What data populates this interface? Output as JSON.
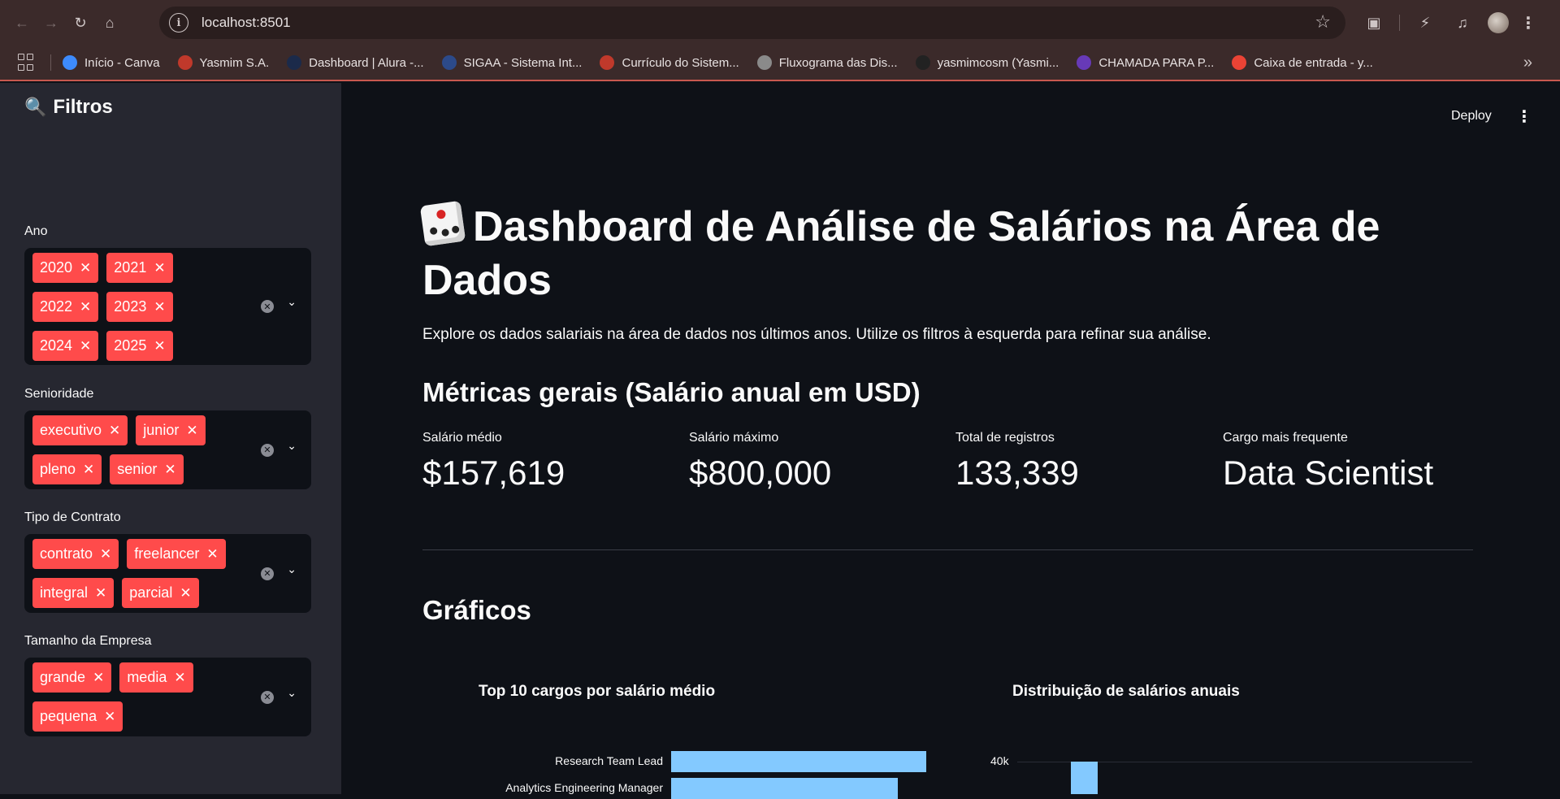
{
  "browser": {
    "url": "localhost:8501",
    "bookmarks": [
      {
        "label": "Início - Canva",
        "icon": "canva-icon",
        "color": "#3d8bfd"
      },
      {
        "label": "Yasmim S.A.",
        "icon": "rose-icon",
        "color": "#c0392b"
      },
      {
        "label": "Dashboard | Alura -...",
        "icon": "alura-icon",
        "color": "#1b2a4a"
      },
      {
        "label": "SIGAA - Sistema Int...",
        "icon": "sigaa-icon",
        "color": "#2c4a8a"
      },
      {
        "label": "Currículo do Sistem...",
        "icon": "lattes-icon",
        "color": "#c0392b"
      },
      {
        "label": "Fluxograma das Dis...",
        "icon": "globe-icon",
        "color": "#8a8a8a"
      },
      {
        "label": "yasmimcosm (Yasmi...",
        "icon": "github-icon",
        "color": "#222222"
      },
      {
        "label": "CHAMADA PARA P...",
        "icon": "forms-icon",
        "color": "#673ab7"
      },
      {
        "label": "Caixa de entrada - y...",
        "icon": "gmail-icon",
        "color": "#ea4335"
      }
    ]
  },
  "header": {
    "deploy_label": "Deploy"
  },
  "sidebar": {
    "title": "Filtros",
    "filters": [
      {
        "label": "Ano",
        "chips": [
          "2020",
          "2021",
          "2022",
          "2023",
          "2024",
          "2025"
        ]
      },
      {
        "label": "Senioridade",
        "chips": [
          "executivo",
          "junior",
          "pleno",
          "senior"
        ]
      },
      {
        "label": "Tipo de Contrato",
        "chips": [
          "contrato",
          "freelancer",
          "integral",
          "parcial"
        ]
      },
      {
        "label": "Tamanho da Empresa",
        "chips": [
          "grande",
          "media",
          "pequena"
        ]
      }
    ]
  },
  "main": {
    "title": "Dashboard de Análise de Salários na Área de Dados",
    "intro": "Explore os dados salariais na área de dados nos últimos anos. Utilize os filtros à esquerda para refinar sua análise.",
    "metrics_heading": "Métricas gerais (Salário anual em USD)",
    "metrics": [
      {
        "label": "Salário médio",
        "value": "$157,619"
      },
      {
        "label": "Salário máximo",
        "value": "$800,000"
      },
      {
        "label": "Total de registros",
        "value": "133,339"
      },
      {
        "label": "Cargo mais frequente",
        "value": "Data Scientist"
      }
    ],
    "charts_heading": "Gráficos",
    "chart_titles": {
      "left": "Top 10 cargos por salário médio",
      "right": "Distribuição de salários anuais"
    }
  },
  "chart_data": [
    {
      "type": "bar",
      "title": "Top 10 cargos por salário médio",
      "orientation": "horizontal",
      "categories": [
        "Research Team Lead",
        "Analytics Engineering Manager"
      ],
      "values": [
        100,
        89
      ],
      "color": "#83c9ff"
    },
    {
      "type": "bar",
      "title": "Distribuição de salários anuais",
      "ytick_labels": [
        "40k"
      ],
      "color": "#83c9ff"
    }
  ]
}
